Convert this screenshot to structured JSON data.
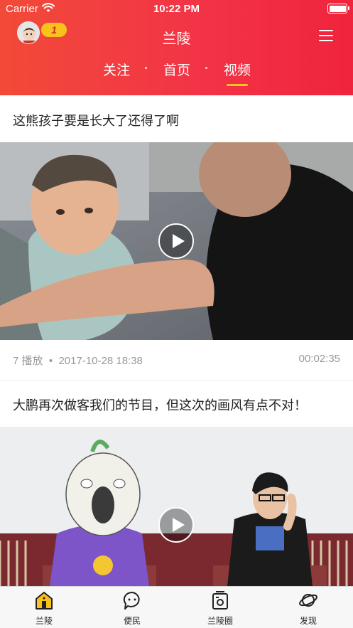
{
  "status_bar": {
    "carrier": "Carrier",
    "time": "10:22 PM"
  },
  "header": {
    "title": "兰陵",
    "badge_count": "1",
    "tabs": [
      {
        "label": "关注",
        "active": false
      },
      {
        "label": "首页",
        "active": false
      },
      {
        "label": "视频",
        "active": true
      }
    ]
  },
  "feed": {
    "posts": [
      {
        "title": "这熊孩子要是长大了还得了啊",
        "plays": "7 播放",
        "date": "2017-10-28 18:38",
        "duration": "00:02:35"
      },
      {
        "title": "大鹏再次做客我们的节目，但这次的画风有点不对！"
      }
    ]
  },
  "bottom_nav": {
    "items": [
      {
        "label": "兰陵",
        "icon": "home-icon",
        "active": true
      },
      {
        "label": "便民",
        "icon": "chat-bubble-icon",
        "active": false
      },
      {
        "label": "兰陵圈",
        "icon": "circle-card-icon",
        "active": false
      },
      {
        "label": "发现",
        "icon": "planet-icon",
        "active": false
      }
    ]
  },
  "colors": {
    "header_start": "#f24a38",
    "header_end": "#f0243c",
    "accent_yellow": "#f7c21b",
    "meta_gray": "#999999"
  }
}
